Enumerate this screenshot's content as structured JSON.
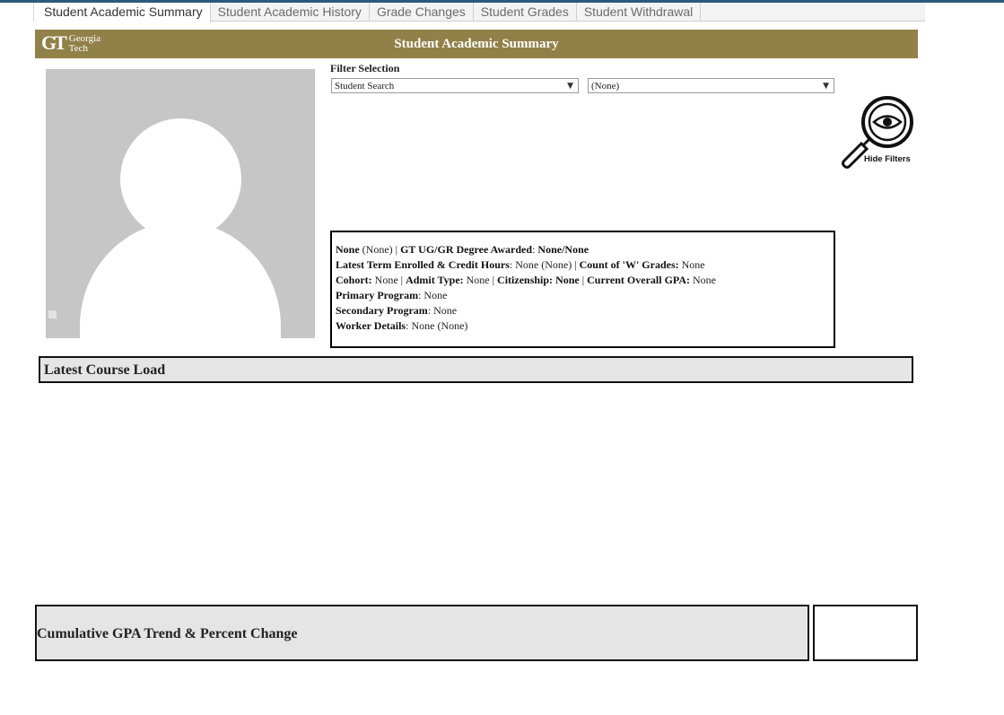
{
  "tabs": [
    {
      "label": "Student Academic Summary",
      "active": true
    },
    {
      "label": "Student Academic History",
      "active": false
    },
    {
      "label": "Grade Changes",
      "active": false
    },
    {
      "label": "Student Grades",
      "active": false
    },
    {
      "label": "Student Withdrawal",
      "active": false
    }
  ],
  "banner": {
    "logo_mark": "GT",
    "logo_line1": "Georgia",
    "logo_line2": "Tech",
    "title": "Student Academic Summary",
    "color": "#918048"
  },
  "photo": {
    "icon": "person-placeholder-icon"
  },
  "filters": {
    "label": "Filter Selection",
    "select1_value": "Student Search",
    "select2_value": "(None)",
    "arrow": "▼"
  },
  "hide_filters": {
    "label": "Hide Filters",
    "icon": "magnifier-eye-icon"
  },
  "info": {
    "name": "None",
    "id": "(None)",
    "degree_label": "GT UG/GR Degree Awarded",
    "degree_value": "None/None",
    "term_label": "Latest Term Enrolled & Credit Hours",
    "term_value": "None (None)",
    "w_label": "Count of 'W' Grades:",
    "w_value": "None",
    "cohort_label": "Cohort:",
    "cohort_value": "None",
    "admit_label": "Admit Type:",
    "admit_value": "None",
    "citizenship_label": "Citizenship:",
    "citizenship_value": "None",
    "gpa_label": "Current Overall GPA:",
    "gpa_value": "None",
    "primary_label": "Primary Program",
    "primary_value": "None",
    "secondary_label": "Secondary Program",
    "secondary_value": "None",
    "worker_label": "Worker Details",
    "worker_value": "None (None)"
  },
  "sections": {
    "course_load": "Latest Course Load",
    "gpa_trend": "Cumulative GPA Trend & Percent Change"
  }
}
